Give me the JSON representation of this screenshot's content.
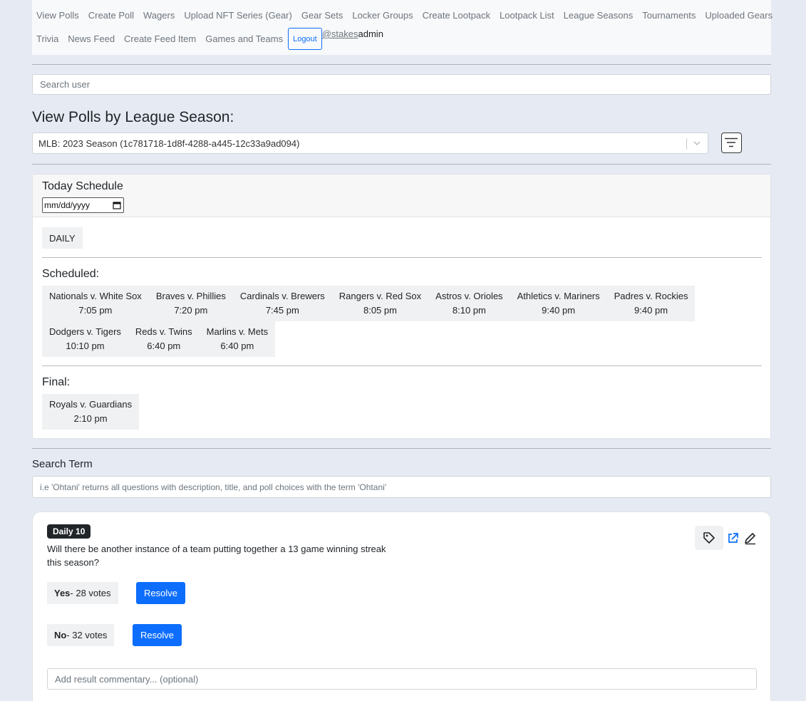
{
  "nav": {
    "row1": [
      "View Polls",
      "Create Poll",
      "Wagers",
      "Upload NFT Series (Gear)",
      "Gear Sets",
      "Locker Groups",
      "Create Lootpack",
      "Lootpack List",
      "League Seasons",
      "Tournaments",
      "Uploaded Gears"
    ],
    "row2": [
      "Trivia",
      "News Feed",
      "Create Feed Item",
      "Games and Teams"
    ],
    "logout": "Logout",
    "user_handle": "@stakes",
    "user_name": "admin"
  },
  "search_user": {
    "placeholder": "Search user"
  },
  "polls_by_season": {
    "title": "View Polls by League Season:",
    "selected": "MLB: 2023 Season (1c781718-1d8f-4288-a445-12c33a9ad094)"
  },
  "schedule": {
    "title": "Today Schedule",
    "date_placeholder": "mm/dd/yyyy",
    "filter_label": "DAILY",
    "scheduled_label": "Scheduled:",
    "scheduled_row1": [
      {
        "teams": "Nationals v. White Sox",
        "time": "7:05 pm"
      },
      {
        "teams": "Braves v. Phillies",
        "time": "7:20 pm"
      },
      {
        "teams": "Cardinals v. Brewers",
        "time": "7:45 pm"
      },
      {
        "teams": "Rangers v. Red Sox",
        "time": "8:05 pm"
      },
      {
        "teams": "Astros v. Orioles",
        "time": "8:10 pm"
      },
      {
        "teams": "Athletics v. Mariners",
        "time": "9:40 pm"
      },
      {
        "teams": "Padres v. Rockies",
        "time": "9:40 pm"
      }
    ],
    "scheduled_row2": [
      {
        "teams": "Dodgers v. Tigers",
        "time": "10:10 pm"
      },
      {
        "teams": "Reds v. Twins",
        "time": "6:40 pm"
      },
      {
        "teams": "Marlins v. Mets",
        "time": "6:40 pm"
      }
    ],
    "final_label": "Final:",
    "final": [
      {
        "teams": "Royals v. Guardians",
        "time": "2:10 pm"
      }
    ]
  },
  "search_term": {
    "label": "Search Term",
    "placeholder": "i.e 'Ohtani' returns all questions with description, title, and poll choices with the term 'Ohtani'"
  },
  "poll": {
    "badge": "Daily 10",
    "question": "Will there be another instance of a team putting together a 13 game winning streak this season?",
    "options": [
      {
        "label": "Yes",
        "votes": " - 28 votes",
        "resolve": "Resolve"
      },
      {
        "label": "No",
        "votes": " - 32 votes",
        "resolve": "Resolve"
      }
    ],
    "commentary_placeholder": "Add result commentary... (optional)"
  },
  "colors": {
    "primary": "#0d6efd",
    "background": "#e6eaf3",
    "badge": "#212529"
  }
}
